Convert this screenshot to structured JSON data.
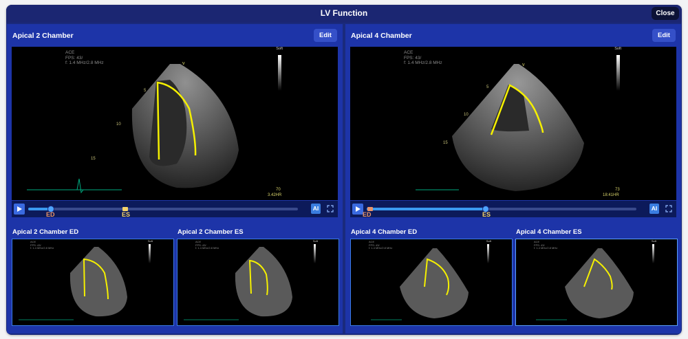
{
  "title": "LV Function",
  "close_label": "Close",
  "panels": [
    {
      "title": "Apical 2 Chamber",
      "edit_label": "Edit",
      "meta": "ACE\nFPS: 43/\nf: 1.4 MHz/2.8 MHz",
      "soft": "Soft",
      "hr_value": "70",
      "hr_label": "3.42HR",
      "depths": [
        "5",
        "10",
        "15"
      ],
      "ed_label": "ED",
      "es_label": "ES",
      "ai_label": "AI",
      "ed_color": "#e8946a",
      "es_color": "#f5d36a",
      "thumbs": [
        {
          "title": "Apical 2 Chamber ED",
          "selected": false
        },
        {
          "title": "Apical 2 Chamber ES",
          "selected": false
        }
      ]
    },
    {
      "title": "Apical 4 Chamber",
      "edit_label": "Edit",
      "meta": "ACE\nFPS: 43/\nf: 1.4 MHz/2.8 MHz",
      "soft": "Soft",
      "hr_value": "73",
      "hr_label": "18:41HR",
      "depths": [
        "5",
        "10",
        "15"
      ],
      "ed_label": "ED",
      "es_label": "ES",
      "ai_label": "AI",
      "ed_color": "#e8946a",
      "es_color": "#f5d36a",
      "thumbs": [
        {
          "title": "Apical 4 Chamber ED",
          "selected": false
        },
        {
          "title": "Apical 4 Chamber ES",
          "selected": true
        }
      ]
    }
  ]
}
